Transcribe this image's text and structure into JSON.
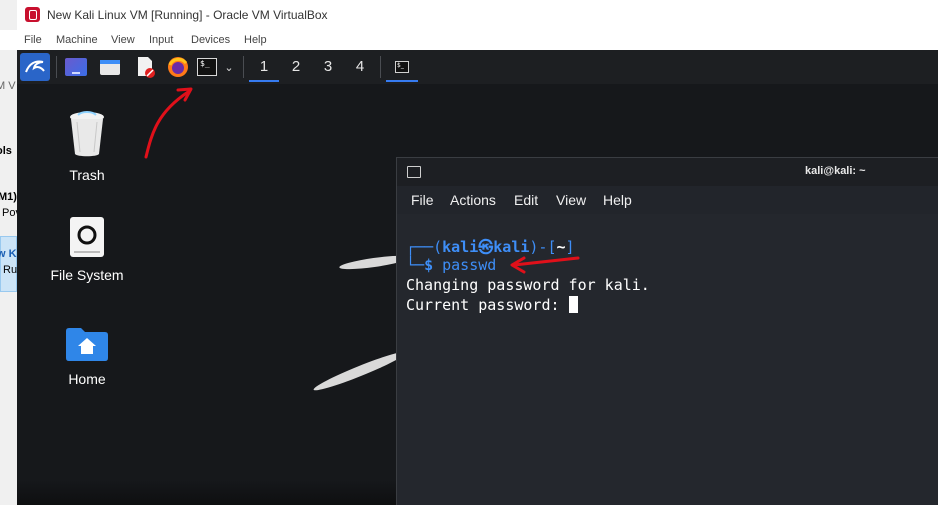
{
  "background_window": {
    "fragments": [
      "M V",
      "ols",
      "M1)",
      "Pov",
      "w K",
      "Ru"
    ]
  },
  "window": {
    "title": "New Kali Linux VM [Running] - Oracle VM VirtualBox",
    "menu": [
      "File",
      "Machine",
      "View",
      "Input",
      "Devices",
      "Help"
    ]
  },
  "panel": {
    "workspaces": [
      "1",
      "2",
      "3",
      "4"
    ],
    "active_workspace": "1"
  },
  "desktop": {
    "icons": [
      {
        "label": "Trash"
      },
      {
        "label": "File System"
      },
      {
        "label": "Home"
      }
    ]
  },
  "terminal": {
    "title": "kali@kali: ~",
    "menu": [
      "File",
      "Actions",
      "Edit",
      "View",
      "Help"
    ],
    "prompt_user": "kali",
    "prompt_host": "kali",
    "prompt_dir": "~",
    "command": "passwd",
    "output": [
      "Changing password for kali.",
      "Current password: "
    ]
  },
  "colors": {
    "accent": "#367bf0",
    "annotation": "#e0101a",
    "terminal_bg": "#24272d"
  }
}
